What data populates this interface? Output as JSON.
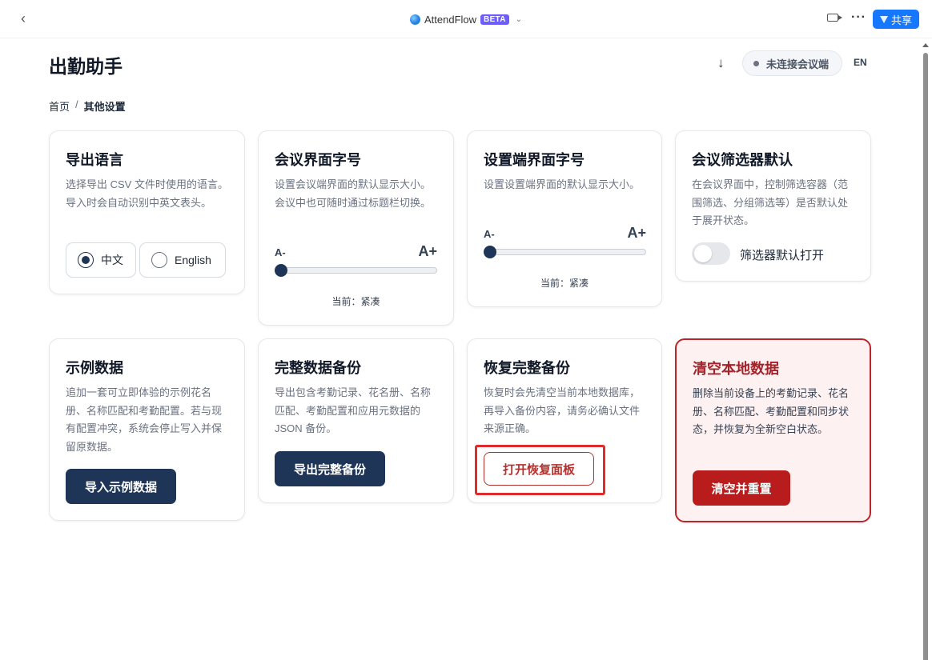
{
  "browser": {
    "app_name": "AttendFlow",
    "badge": "BETA",
    "share_label": "共享"
  },
  "header": {
    "title": "出勤助手",
    "status": "未连接会议端",
    "lang_toggle": "EN",
    "download_glyph": "↓"
  },
  "breadcrumb": {
    "home": "首页",
    "sep": "/",
    "current": "其他设置"
  },
  "cards": {
    "export_lang": {
      "title": "导出语言",
      "desc": "选择导出 CSV 文件时使用的语言。导入时会自动识别中英文表头。",
      "options": [
        "中文",
        "English"
      ],
      "selected": "中文"
    },
    "meeting_font": {
      "title": "会议界面字号",
      "desc": "设置会议端界面的默认显示大小。会议中也可随时通过标题栏切换。",
      "minus": "A-",
      "plus": "A+",
      "current": "当前：紧凑",
      "level": 0
    },
    "settings_font": {
      "title": "设置端界面字号",
      "desc": "设置设置端界面的默认显示大小。",
      "minus": "A-",
      "plus": "A+",
      "current": "当前：紧凑",
      "level": 0
    },
    "filter_default": {
      "title": "会议筛选器默认",
      "desc": "在会议界面中，控制筛选容器（范围筛选、分组筛选等）是否默认处于展开状态。",
      "toggle_label": "筛选器默认打开",
      "toggle_on": false
    },
    "sample_data": {
      "title": "示例数据",
      "desc": "追加一套可立即体验的示例花名册、名称匹配和考勤配置。若与现有配置冲突，系统会停止写入并保留原数据。",
      "button": "导入示例数据"
    },
    "full_backup": {
      "title": "完整数据备份",
      "desc": "导出包含考勤记录、花名册、名称匹配、考勤配置和应用元数据的 JSON 备份。",
      "button": "导出完整备份"
    },
    "restore_backup": {
      "title": "恢复完整备份",
      "desc": "恢复时会先清空当前本地数据库，再导入备份内容，请务必确认文件来源正确。",
      "button": "打开恢复面板"
    },
    "clear_data": {
      "title": "清空本地数据",
      "desc": "删除当前设备上的考勤记录、花名册、名称匹配、考勤配置和同步状态，并恢复为全新空白状态。",
      "button": "清空并重置"
    }
  },
  "colors": {
    "primary": "#1e3557",
    "danger": "#b91c1c",
    "share": "#1677ff",
    "highlight": "#e02b2b"
  }
}
